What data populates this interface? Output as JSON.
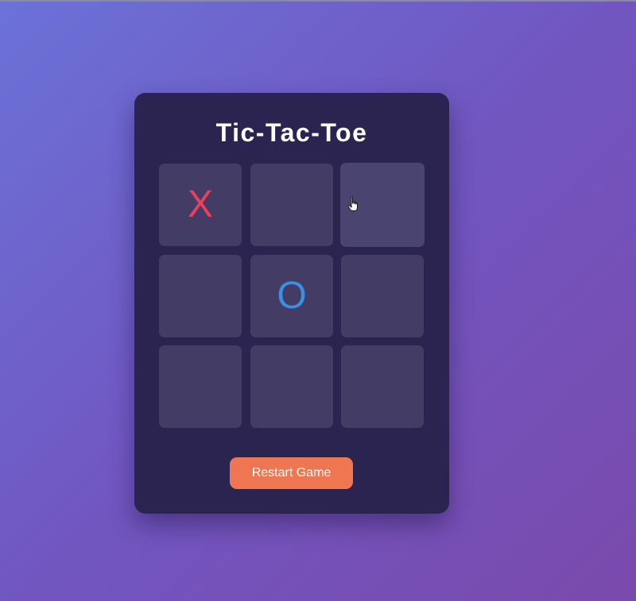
{
  "game": {
    "title": "Tic-Tac-Toe",
    "board": [
      "X",
      "",
      "",
      "",
      "O",
      "",
      "",
      "",
      ""
    ],
    "hovered_cell": 2
  },
  "controls": {
    "restart_label": "Restart Game"
  },
  "colors": {
    "x_mark": "#e8405e",
    "o_mark": "#3a8fe6",
    "button": "#ee7752",
    "card": "#2b2450",
    "cell": "#433c65"
  },
  "icons": {
    "pointer": "hand-pointer-icon"
  }
}
